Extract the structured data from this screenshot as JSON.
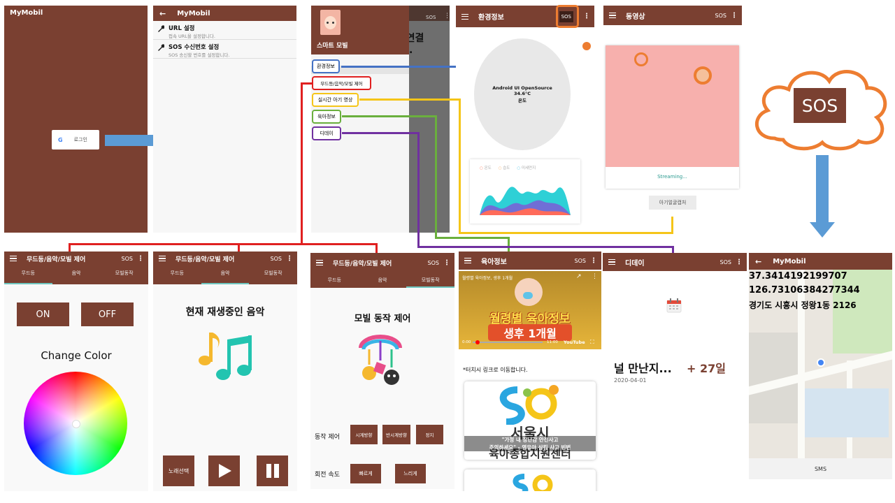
{
  "login": {
    "app_title": "MyMobil",
    "google_glyph": "G",
    "login_label": "로그인"
  },
  "settings": {
    "app_title": "MyMobil",
    "back_glyph": "←",
    "items": [
      {
        "title": "URL 설정",
        "subtitle": "접속 URL을 설정합니다."
      },
      {
        "title": "SOS 수신번호 설정",
        "subtitle": "SOS 송신할 번호를 설정합니다."
      }
    ]
  },
  "drawer": {
    "title": "스마트 모빌",
    "bg_text1": "!! 연결",
    "bg_text2": ".",
    "sos": "SOS",
    "items": [
      "환경정보",
      "무드등/음악/모빌 제어",
      "실시간 아기 영상",
      "육아정보",
      "디데이"
    ]
  },
  "env": {
    "title": "환경정보",
    "sos": "SOS",
    "circle_line1": "Android UI OpenSource",
    "circle_line2": "34.6°C",
    "circle_line3": "온도",
    "legend": [
      "온도",
      "습도",
      "미세먼지"
    ]
  },
  "video": {
    "title": "동영상",
    "sos": "SOS",
    "streaming": "Streaming...",
    "capture_button": "아기얼굴캡처"
  },
  "cloud": {
    "sos": "SOS"
  },
  "mood": {
    "title": "무드등/음악/모빌 제어",
    "sos": "SOS",
    "tabs": [
      "무드등",
      "음악",
      "모빌동작"
    ],
    "on": "ON",
    "off": "OFF",
    "change_color": "Change Color"
  },
  "music": {
    "title": "무드등/음악/모빌 제어",
    "sos": "SOS",
    "tabs": [
      "무드등",
      "음악",
      "모빌동작"
    ],
    "now_playing": "현재 재생중인 음악",
    "select_song": "노래선택"
  },
  "mobile": {
    "title": "무드등/음악/모빌 제어",
    "sos": "SOS",
    "tabs": [
      "무드등",
      "음악",
      "모빌동작"
    ],
    "heading": "모빌 동작 제어",
    "action_label": "동작 제어",
    "actions": [
      "시계방향",
      "반시계방향",
      "정지"
    ],
    "speed_label": "회전 속도",
    "speeds": [
      "빠르게",
      "느리게"
    ]
  },
  "parenting": {
    "title": "육아정보",
    "sos": "SOS",
    "video_title": "월령별 육아정보, 생후 1개월",
    "banner_line1": "월령별 육아정보",
    "banner_line2": "생후 1개월",
    "time": "0:00",
    "duration": "11:00",
    "youtube": "YouTube",
    "hint": "*터치시 링크로 이동합니다.",
    "card_title": "서울시",
    "card_title2": "육아종합지원센터",
    "card_caption1": "\"가정 내 장난감 안전사고",
    "card_caption2": "주의하세요\" - 영유아 삼킴 사고 빈번"
  },
  "dday": {
    "title": "디데이",
    "sos": "SOS",
    "headline": "널 만난지...",
    "count": "+ 27일",
    "date": "2020-04-01"
  },
  "map": {
    "title": "MyMobil",
    "back_glyph": "←",
    "lat": "37.3414192199707",
    "lng": "126.73106384277344",
    "address": "경기도 시흥시 정왕1동 2126",
    "sms_button": "SMS"
  },
  "colors": {
    "brown": "#7a4031",
    "teal": "#6ec7c0",
    "orange": "#ed7d31",
    "blue": "#5b9bd5",
    "red": "#e02020",
    "yellow": "#f5c518",
    "green": "#6aaf3d",
    "purple": "#7030a0"
  }
}
